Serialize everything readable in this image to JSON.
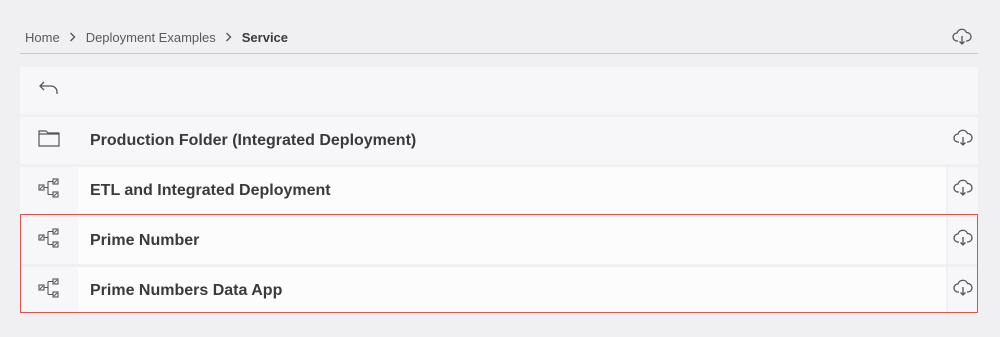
{
  "breadcrumb": {
    "items": [
      "Home",
      "Deployment Examples",
      "Service"
    ]
  },
  "icons": {
    "header_download": "cloud-download-icon",
    "back": "back-arrow-icon",
    "folder": "folder-icon",
    "workflow": "workflow-icon",
    "row_download": "cloud-download-icon",
    "separator": "chevron-right-icon"
  },
  "list": {
    "items": [
      {
        "label": "Production Folder (Integrated Deployment)",
        "type": "folder"
      },
      {
        "label": "ETL and Integrated Deployment",
        "type": "workflow"
      },
      {
        "label": "Prime Number",
        "type": "workflow"
      },
      {
        "label": "Prime Numbers Data App",
        "type": "workflow"
      }
    ]
  },
  "colors": {
    "background": "#f0f0f3",
    "highlight_border": "#d9534f",
    "text": "#3a3a3a"
  }
}
